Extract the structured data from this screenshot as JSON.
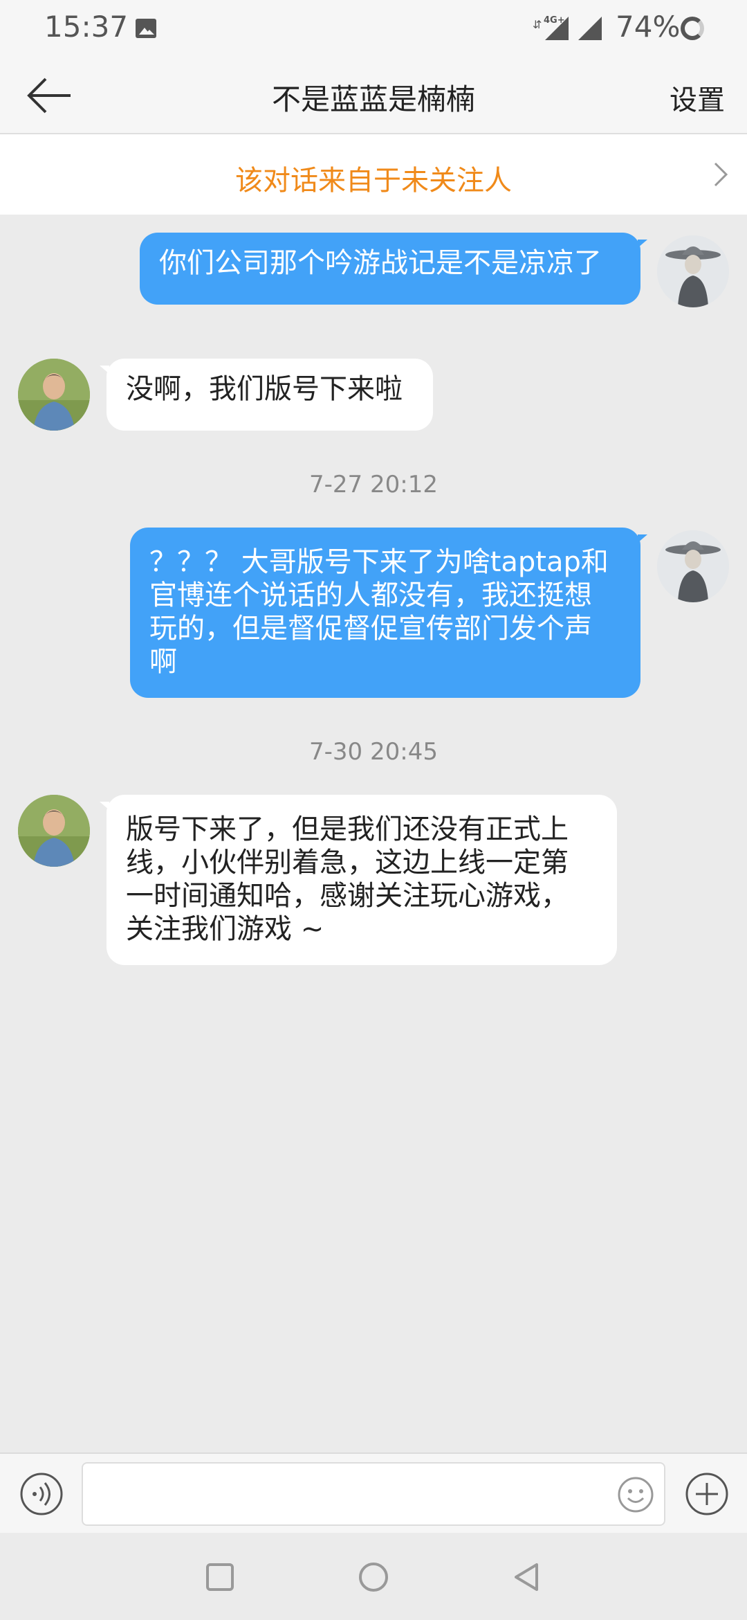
{
  "status_bar": {
    "time": "15:37",
    "network_label": "4G+",
    "battery": "74%",
    "icons": [
      "image-icon",
      "data-arrows-icon",
      "signal-icon",
      "signal-icon",
      "battery-ring-icon"
    ]
  },
  "header": {
    "back_icon": "back-arrow-icon",
    "title": "不是蓝蓝是楠楠",
    "settings_label": "设置"
  },
  "notice": {
    "text": "该对话来自于未关注人",
    "icon": "chevron-right-icon"
  },
  "messages": [
    {
      "type": "outgoing",
      "text": "你们公司那个吟游战记是不是凉凉了"
    },
    {
      "type": "incoming",
      "text": "没啊，我们版号下来啦"
    },
    {
      "type": "timestamp",
      "text": "7-27 20:12"
    },
    {
      "type": "outgoing",
      "lines": [
        "？？？ 大哥版号下来了为啥taptap和",
        "官博连个说话的人都没有，我还挺想",
        "玩的，但是督促督促宣传部门发个声",
        "啊"
      ]
    },
    {
      "type": "timestamp",
      "text": "7-30 20:45"
    },
    {
      "type": "incoming",
      "lines": [
        "版号下来了，但是我们还没有正式上",
        "线，小伙伴别着急，这边上线一定第",
        "一时间通知哈，感谢关注玩心游戏，",
        "关注我们游戏 ~"
      ]
    }
  ],
  "input_bar": {
    "value": "",
    "placeholder": "",
    "voice_icon": "voice-icon",
    "emoji_icon": "emoji-icon",
    "plus_icon": "plus-icon"
  },
  "nav_bar": {
    "icons": [
      "recents-square-icon",
      "home-circle-icon",
      "back-triangle-icon"
    ]
  },
  "colors": {
    "accent_blue": "#42a2f8",
    "notice_orange": "#f08a1a",
    "background": "#ebebeb"
  }
}
